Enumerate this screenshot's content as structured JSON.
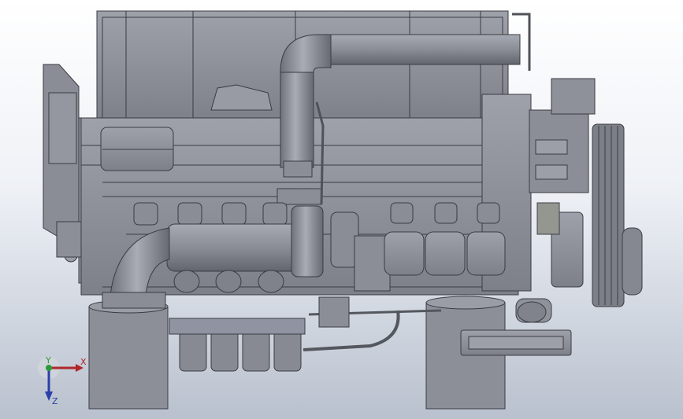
{
  "viewport": {
    "model_name": "",
    "colors": {
      "bg_top": "#ffffff",
      "bg_bottom": "#b9c1ce",
      "metal": "#8d9099",
      "metal_dark": "#5f626b",
      "edge": "#3a3c42"
    }
  },
  "triad": {
    "x_label": "X",
    "y_label": "Y",
    "z_label": "Z",
    "colors": {
      "x": "#b0262a",
      "y": "#2b9a3a",
      "z": "#2a3fa8"
    }
  }
}
